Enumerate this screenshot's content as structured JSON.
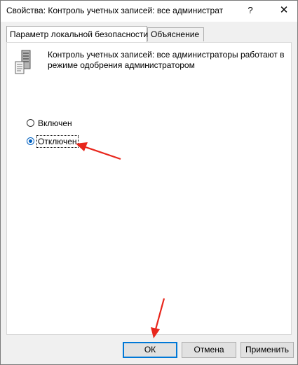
{
  "window": {
    "title": "Свойства: Контроль учетных записей: все администрат",
    "help_label": "?",
    "close_label": "✕"
  },
  "tabs": [
    {
      "label": "Параметр локальной безопасности",
      "active": true
    },
    {
      "label": "Объяснение",
      "active": false
    }
  ],
  "policy": {
    "icon": "server-icon",
    "description": "Контроль учетных записей: все администраторы работают в режиме одобрения администратором"
  },
  "options": {
    "enabled_label": "Включен",
    "disabled_label": "Отключен",
    "selected": "disabled"
  },
  "buttons": {
    "ok_label": "ОК",
    "cancel_label": "Отмена",
    "apply_label": "Применить"
  },
  "colors": {
    "accent": "#0078d7",
    "annotation": "#e8261c"
  }
}
